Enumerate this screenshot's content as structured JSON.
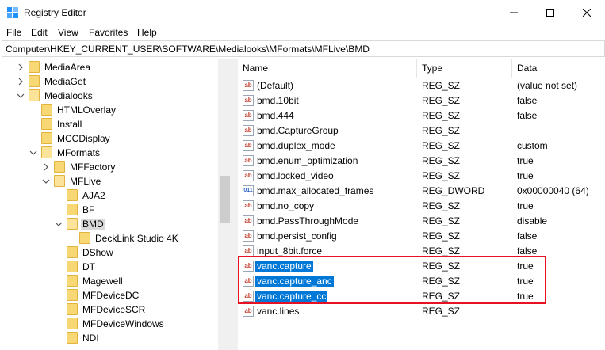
{
  "window": {
    "title": "Registry Editor",
    "minimize_icon": "minimize-icon",
    "maximize_icon": "maximize-icon",
    "close_icon": "close-icon"
  },
  "menu": [
    "File",
    "Edit",
    "View",
    "Favorites",
    "Help"
  ],
  "address": {
    "path": "Computer\\HKEY_CURRENT_USER\\SOFTWARE\\Medialooks\\MFormats\\MFLive\\BMD"
  },
  "tree": [
    {
      "label": "MediaArea",
      "chevron": "right",
      "selected": false
    },
    {
      "label": "MediaGet",
      "chevron": "right",
      "selected": false
    },
    {
      "label": "Medialooks",
      "chevron": "down",
      "selected": false
    },
    {
      "label": "HTMLOverlay",
      "chevron": "none",
      "selected": false
    },
    {
      "label": "Install",
      "chevron": "none",
      "selected": false
    },
    {
      "label": "MCCDisplay",
      "chevron": "none",
      "selected": false
    },
    {
      "label": "MFormats",
      "chevron": "down",
      "selected": false
    },
    {
      "label": "MFFactory",
      "chevron": "right",
      "selected": false
    },
    {
      "label": "MFLive",
      "chevron": "down",
      "selected": false
    },
    {
      "label": "AJA2",
      "chevron": "none",
      "selected": false
    },
    {
      "label": "BF",
      "chevron": "none",
      "selected": false
    },
    {
      "label": "BMD",
      "chevron": "down",
      "selected": true
    },
    {
      "label": "DeckLink Studio 4K",
      "chevron": "none",
      "selected": false
    },
    {
      "label": "DShow",
      "chevron": "none",
      "selected": false
    },
    {
      "label": "DT",
      "chevron": "none",
      "selected": false
    },
    {
      "label": "Magewell",
      "chevron": "none",
      "selected": false
    },
    {
      "label": "MFDeviceDC",
      "chevron": "none",
      "selected": false
    },
    {
      "label": "MFDeviceSCR",
      "chevron": "none",
      "selected": false
    },
    {
      "label": "MFDeviceWindows",
      "chevron": "none",
      "selected": false
    },
    {
      "label": "NDI",
      "chevron": "none",
      "selected": false
    }
  ],
  "columns": {
    "name": "Name",
    "type": "Type",
    "data": "Data"
  },
  "values": [
    {
      "name": "(Default)",
      "type": "REG_SZ",
      "data": "(value not set)",
      "icon": "ab",
      "selected": false
    },
    {
      "name": "bmd.10bit",
      "type": "REG_SZ",
      "data": "false",
      "icon": "ab",
      "selected": false
    },
    {
      "name": "bmd.444",
      "type": "REG_SZ",
      "data": "false",
      "icon": "ab",
      "selected": false
    },
    {
      "name": "bmd.CaptureGroup",
      "type": "REG_SZ",
      "data": "",
      "icon": "ab",
      "selected": false
    },
    {
      "name": "bmd.duplex_mode",
      "type": "REG_SZ",
      "data": "custom",
      "icon": "ab",
      "selected": false
    },
    {
      "name": "bmd.enum_optimization",
      "type": "REG_SZ",
      "data": "true",
      "icon": "ab",
      "selected": false
    },
    {
      "name": "bmd.locked_video",
      "type": "REG_SZ",
      "data": "true",
      "icon": "ab",
      "selected": false
    },
    {
      "name": "bmd.max_allocated_frames",
      "type": "REG_DWORD",
      "data": "0x00000040 (64)",
      "icon": "011",
      "selected": false
    },
    {
      "name": "bmd.no_copy",
      "type": "REG_SZ",
      "data": "true",
      "icon": "ab",
      "selected": false
    },
    {
      "name": "bmd.PassThroughMode",
      "type": "REG_SZ",
      "data": "disable",
      "icon": "ab",
      "selected": false
    },
    {
      "name": "bmd.persist_config",
      "type": "REG_SZ",
      "data": "false",
      "icon": "ab",
      "selected": false
    },
    {
      "name": "input_8bit.force",
      "type": "REG_SZ",
      "data": "false",
      "icon": "ab",
      "selected": false
    },
    {
      "name": "vanc.capture",
      "type": "REG_SZ",
      "data": "true",
      "icon": "ab",
      "selected": true
    },
    {
      "name": "vanc.capture_anc",
      "type": "REG_SZ",
      "data": "true",
      "icon": "ab",
      "selected": true
    },
    {
      "name": "vanc.capture_cc",
      "type": "REG_SZ",
      "data": "true",
      "icon": "ab",
      "selected": true
    },
    {
      "name": "vanc.lines",
      "type": "REG_SZ",
      "data": "",
      "icon": "ab",
      "selected": false
    }
  ],
  "colors": {
    "selection": "#0078d7",
    "highlight_box": "#e81123",
    "folder": "#f8d775"
  }
}
